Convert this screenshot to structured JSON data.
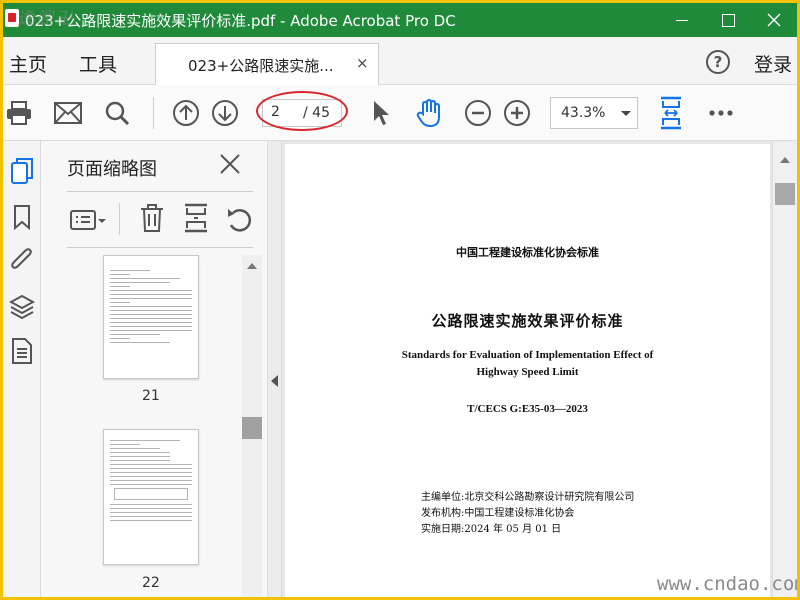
{
  "window": {
    "title": "023+公路限速实施效果评价标准.pdf - Adobe Acrobat Pro DC",
    "watermark_left": "逸阁卍",
    "watermark_right": "www.cndao.com"
  },
  "menubar": {
    "home": "主页",
    "tools": "工具",
    "doc_tab_label": "023+公路限速实施...",
    "doc_tab_close": "×",
    "help_icon": "?",
    "login": "登录"
  },
  "toolbar": {
    "icons": [
      "print-icon",
      "mail-icon",
      "search-icon",
      "page-up-icon",
      "page-down-icon",
      "cursor-icon",
      "hand-icon",
      "zoom-out-icon",
      "zoom-in-icon",
      "fit-page-icon",
      "more-icon"
    ],
    "current_page": "2",
    "total_pages": "/ 45",
    "zoom": "43.3%",
    "annotation_color": "#d8262a"
  },
  "left_rail": {
    "icons": [
      "page-thumbnails-icon",
      "bookmark-icon",
      "attachment-icon",
      "layers-icon",
      "document-icon"
    ]
  },
  "thumbnail_panel": {
    "title": "页面缩略图",
    "close": "×",
    "tool_icons": [
      "thumbnail-options-icon",
      "delete-icon",
      "insert-page-icon",
      "rotate-icon"
    ],
    "pages": [
      {
        "number": "21"
      },
      {
        "number": "22"
      }
    ]
  },
  "document": {
    "org": "中国工程建设标准化协会标准",
    "title_cn": "公路限速实施效果评价标准",
    "title_en_line1": "Standards for Evaluation of Implementation Effect of",
    "title_en_line2": "Highway Speed Limit",
    "code": "T/CECS G:E35-03—2023",
    "editor": "主编单位:北京交科公路勘察设计研究院有限公司",
    "publisher": "发布机构:中国工程建设标准化协会",
    "effective_date": "实施日期:2024 年 05 月 01 日"
  },
  "colors": {
    "titlebar": "#1f8a3a",
    "accent_blue": "#1473e6",
    "frame": "#f2c200"
  }
}
